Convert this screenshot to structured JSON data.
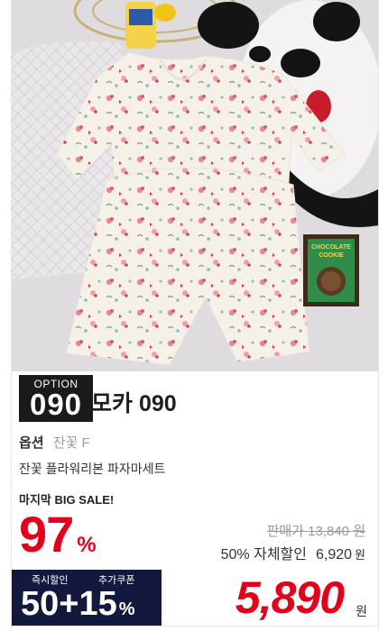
{
  "product": {
    "option_label": "OPTION",
    "option_number": "090",
    "title": "모카 090",
    "option_key": "옵션",
    "option_value": "잔꽃 F",
    "description": "잔꽃 플라워리본 파자마세트"
  },
  "sale": {
    "tag": "마지막 BIG SALE!",
    "discount_number": "97",
    "discount_symbol": "%",
    "original_price": "판매가 13,840 원",
    "self_discount_label": "50% 자체할인",
    "self_price": "6,920",
    "won": "원"
  },
  "deal": {
    "instant_label": "즉시할인",
    "coupon_label": "추가쿠폰",
    "combo": "50+15",
    "percent": "%",
    "final_price": "5,890",
    "final_unit": "원"
  },
  "chocolate_box": [
    "CHOCOLATE",
    "COOKIE"
  ],
  "colors": {
    "accent_red": "#e4001b",
    "badge_dark": "#1a1a1a",
    "deal_navy": "#13193d"
  }
}
